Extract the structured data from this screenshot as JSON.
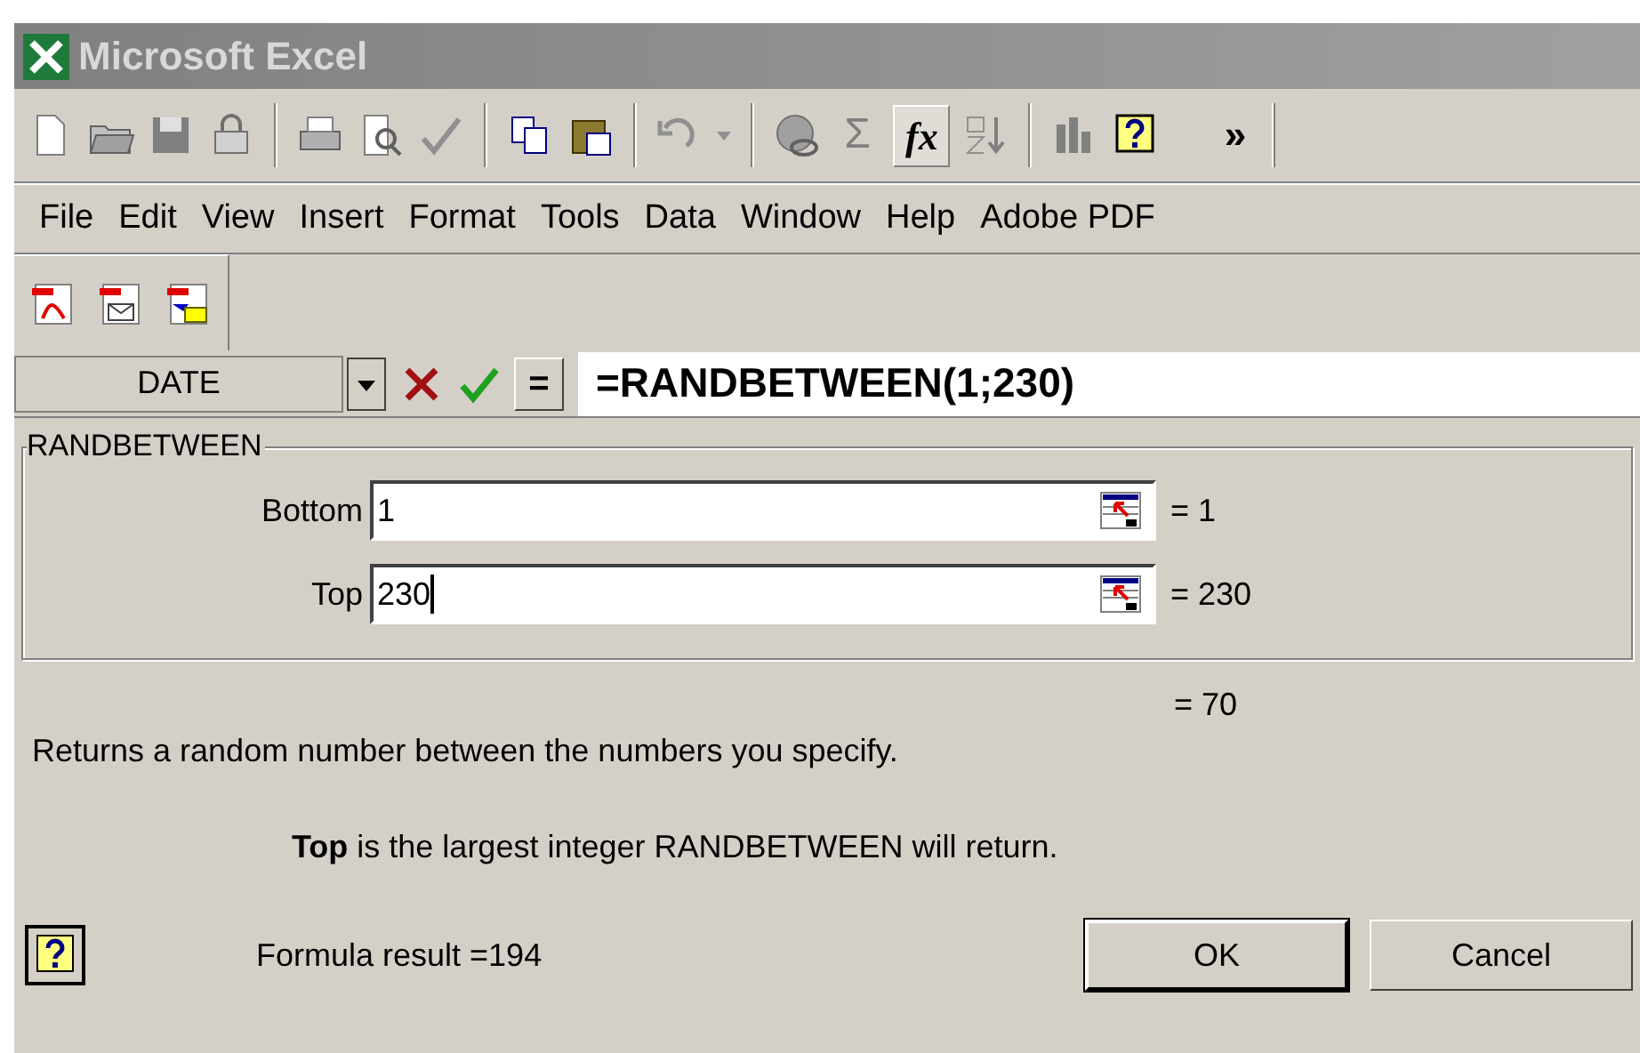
{
  "window": {
    "title": "Microsoft Excel"
  },
  "toolbar": {
    "sum_label": "Σ",
    "function_label": "fx",
    "function_pressed": true,
    "more": "»"
  },
  "menu": [
    {
      "label": "File"
    },
    {
      "label": "Edit"
    },
    {
      "label": "View"
    },
    {
      "label": "Insert"
    },
    {
      "label": "Format"
    },
    {
      "label": "Tools"
    },
    {
      "label": "Data"
    },
    {
      "label": "Window"
    },
    {
      "label": "Help"
    },
    {
      "label": "Adobe PDF"
    }
  ],
  "formula_bar": {
    "name_box": "DATE",
    "equals_button": "=",
    "formula": "=RANDBETWEEN(1;230)"
  },
  "dialog": {
    "function_name": "RANDBETWEEN",
    "arguments": [
      {
        "label": "Bottom",
        "value": "1",
        "result": "= 1",
        "focused": false
      },
      {
        "label": "Top",
        "value": "230",
        "result": "= 230",
        "focused": true
      }
    ],
    "result": "= 70",
    "description": "Returns a random number between the numbers you specify.",
    "argument_help": "**Top** is the largest integer RANDBETWEEN will return.",
    "formula_result": "Formula result =194",
    "buttons": [
      {
        "label": "OK",
        "default": true
      },
      {
        "label": "Cancel",
        "default": false
      }
    ]
  }
}
